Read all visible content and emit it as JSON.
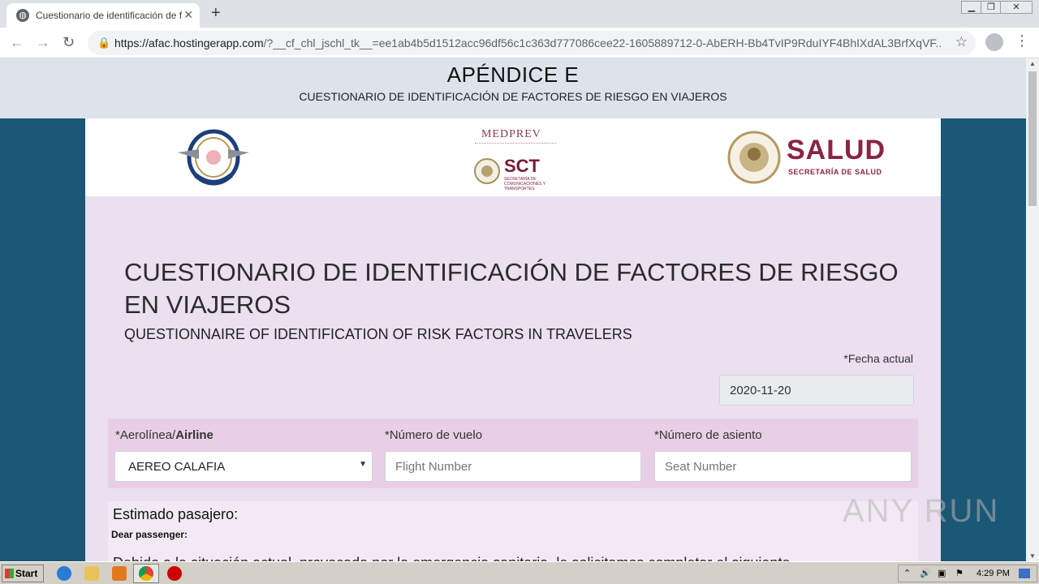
{
  "browser": {
    "tab_title": "Cuestionario de identificación de fact",
    "url_host": "https://afac.hostingerapp.com",
    "url_rest": "/?__cf_chl_jschl_tk__=ee1ab4b5d1512acc96df56c1c363d777086cee22-1605889712-0-AbERH-Bb4TvIP9RduIYF4BhIXdAL3BrfXqVF..."
  },
  "header": {
    "title": "APÉNDICE E",
    "subtitle": "CUESTIONARIO DE IDENTIFICACIÓN DE FACTORES DE RIESGO EN VIAJEROS"
  },
  "logos": {
    "medprev": "MEDPREV",
    "sct": "SCT",
    "sct_sub": "SECRETARÍA DE COMUNICACIONES Y TRANSPORTES",
    "salud": "SALUD",
    "salud_sub": "SECRETARÍA DE SALUD"
  },
  "form": {
    "title": "CUESTIONARIO DE IDENTIFICACIÓN DE FACTORES DE RIESGO EN VIAJEROS",
    "subtitle": "QUESTIONNAIRE OF IDENTIFICATION OF RISK FACTORS IN TRAVELERS",
    "date_label": "*Fecha actual",
    "date_value": "2020-11-20",
    "airline_label_es": "*Aerolínea/",
    "airline_label_en": "Airline",
    "airline_value": "AEREO CALAFIA",
    "flight_label": "*Número de vuelo",
    "flight_placeholder": "Flight Number",
    "seat_label": "*Número de asiento",
    "seat_placeholder": "Seat Number",
    "passenger_title": "Estimado pasajero:",
    "passenger_sub": "Dear passenger:",
    "passenger_text": "Debido a la situación actual, provocada por la emergencia sanitaria, le solicitamos completar el siguiente"
  },
  "watermark": "ANY RUN",
  "taskbar": {
    "start": "Start",
    "clock": "4:29 PM"
  }
}
